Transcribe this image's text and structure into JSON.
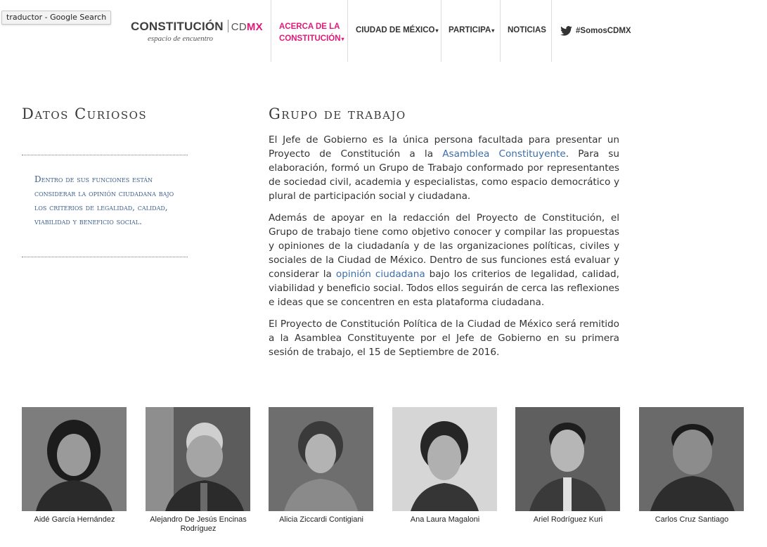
{
  "tooltip": "traductor - Google Search",
  "logo": {
    "main": "CONSTITUCIÓN",
    "cd": "CD",
    "mx": "MX",
    "subtitle": "espacio de encuentro"
  },
  "nav": {
    "acerca": "ACERCA DE LA CONSTITUCIÓN",
    "cdmx": "CIUDAD DE MÉXICO",
    "participa": "PARTICIPA",
    "noticias": "NOTICIAS",
    "twitter": "#SomosCDMX",
    "caret": "▾"
  },
  "sidebar": {
    "title": "Datos Curiosos",
    "text": "Dentro de sus funciones están considerar la opinión ciudadana bajo los criterios de legalidad, calidad, viabilidad y beneficio social."
  },
  "main": {
    "title": "Grupo de trabajo",
    "p1_a": "El Jefe de Gobierno es la única persona facultada para presentar un Proyecto de Constitución a la ",
    "p1_link": "Asamblea Constituyente",
    "p1_b": ". Para su elaboración, formó un Grupo de Trabajo conformado por representantes de sociedad civil, academia y especialistas, como espacio democrático y plural de participación social y ciudadana.",
    "p2_a": "Además de apoyar en la redacción del Proyecto de Constitución, el Grupo de trabajo tiene como objetivo conocer y compilar las propuestas y opiniones de la ciudadanía y de las organizaciones políticas, civiles y sociales de la Ciudad de México. Dentro de sus funciones está evaluar y considerar la ",
    "p2_link": "opinión ciudadana",
    "p2_b": " bajo los criterios de legalidad, calidad, viabilidad y beneficio social. Todos ellos seguirán de cerca las reflexiones e ideas que se concentren en esta plataforma ciudadana.",
    "p3": "El Proyecto de Constitución Política de la Ciudad de México será remitido a la Asamblea Constituyente por el Jefe de Gobierno en su primera sesión de trabajo, el 15 de Septiembre de 2016."
  },
  "people": [
    {
      "name": "Aidé García Hernández"
    },
    {
      "name": "Alejandro De Jesús Encinas Rodríguez"
    },
    {
      "name": "Alicia Ziccardi Contigiani"
    },
    {
      "name": "Ana Laura Magaloni"
    },
    {
      "name": "Ariel Rodríguez Kuri"
    },
    {
      "name": "Carlos Cruz Santiago"
    }
  ],
  "colors": {
    "accent": "#e0197a",
    "link": "#3b6ea8",
    "sidebar_text": "#3b5f8c"
  }
}
